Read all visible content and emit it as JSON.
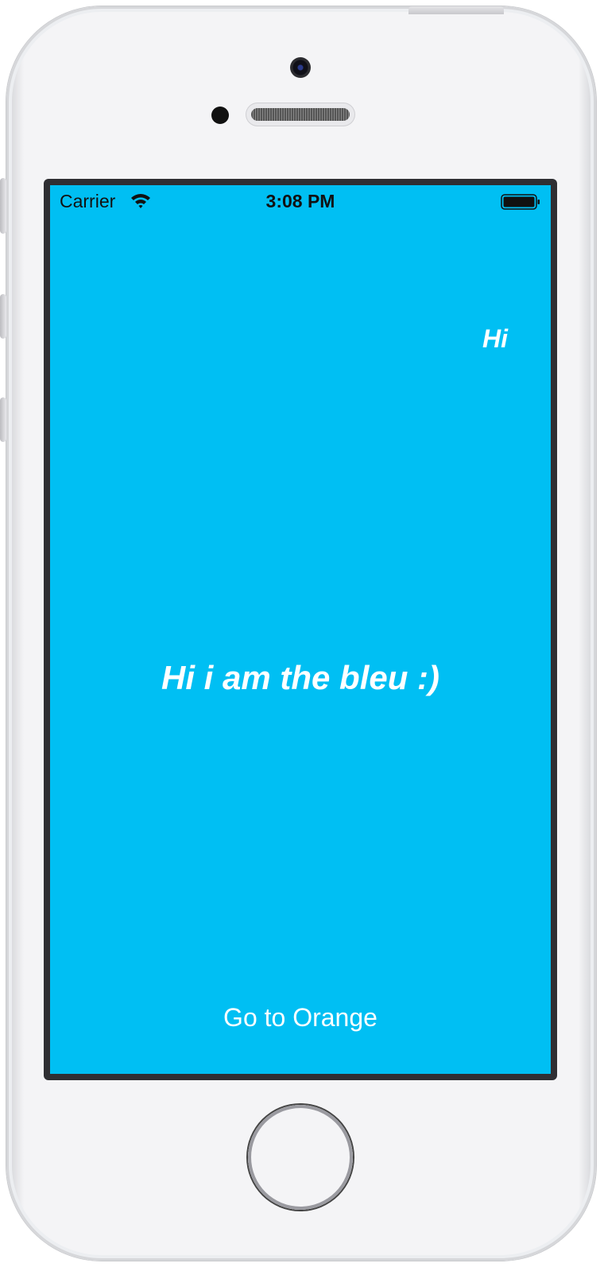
{
  "status_bar": {
    "carrier": "Carrier",
    "time": "3:08 PM",
    "wifi_icon": "wifi-icon",
    "battery_icon": "battery-icon"
  },
  "screen": {
    "background_color": "#00bff3",
    "text_color": "#ffffff",
    "corner_label": "Hi",
    "main_label": "Hi i am the bleu :)",
    "button_label": "Go to Orange"
  },
  "device": {
    "home_button_icon": "home-button"
  }
}
